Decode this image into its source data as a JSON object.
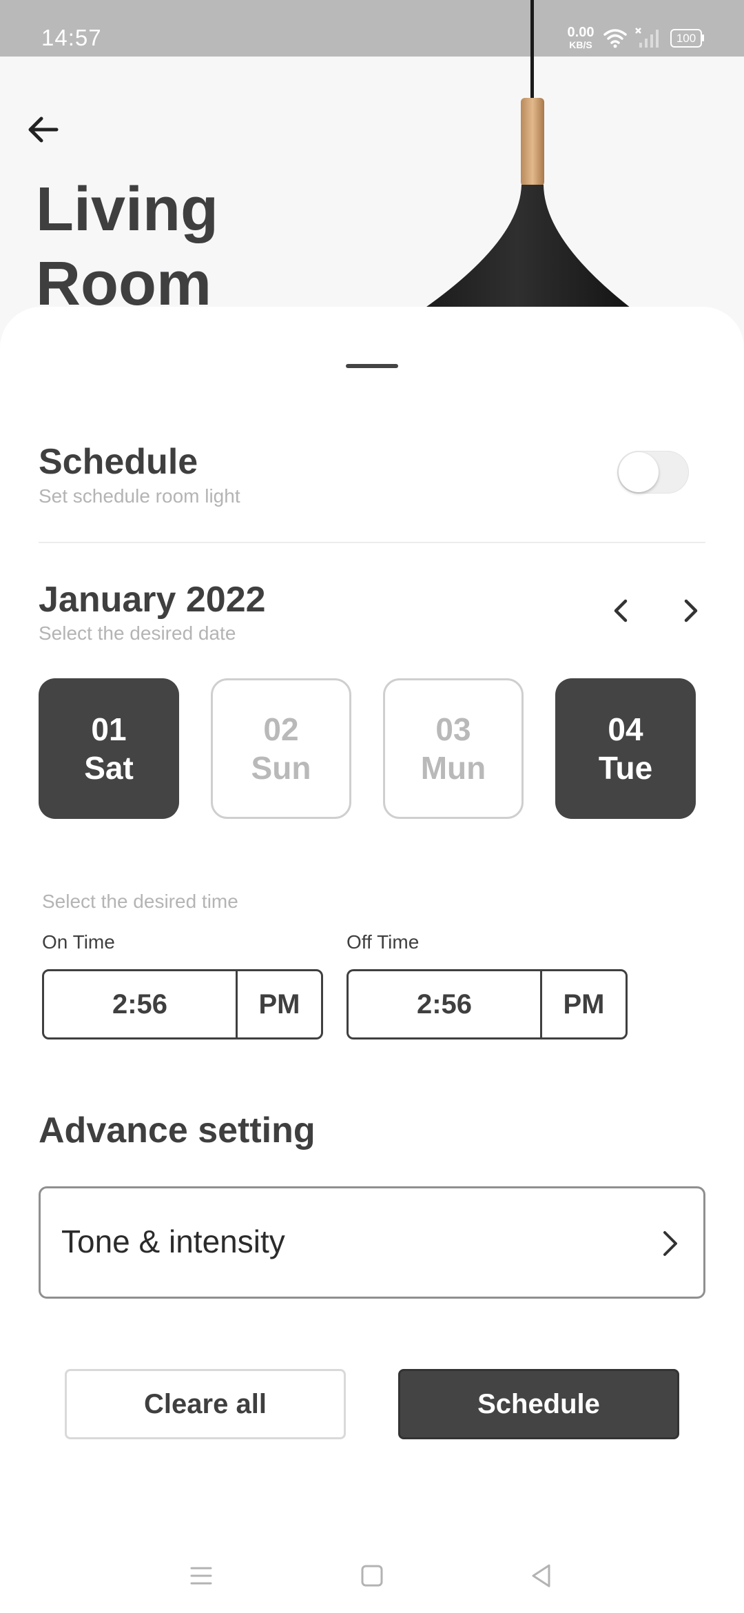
{
  "status_bar": {
    "time": "14:57",
    "speed_value": "0.00",
    "speed_unit": "KB/S",
    "battery": "100"
  },
  "header": {
    "title_line1": "Living",
    "title_line2": "Room"
  },
  "schedule": {
    "title": "Schedule",
    "subtitle": "Set schedule room light",
    "enabled": false
  },
  "calendar": {
    "month": "January 2022",
    "subtitle": "Select the desired date",
    "dates": [
      {
        "day": "01",
        "weekday": "Sat",
        "selected": true
      },
      {
        "day": "02",
        "weekday": "Sun",
        "selected": false
      },
      {
        "day": "03",
        "weekday": "Mun",
        "selected": false
      },
      {
        "day": "04",
        "weekday": "Tue",
        "selected": true
      }
    ]
  },
  "time": {
    "subtitle": "Select the desired time",
    "on_label": "On Time",
    "on_value": "2:56",
    "on_period": "PM",
    "off_label": "Off Time",
    "off_value": "2:56",
    "off_period": "PM"
  },
  "advance": {
    "title": "Advance setting",
    "tone_label": "Tone & intensity"
  },
  "actions": {
    "clear_label": "Cleare all",
    "schedule_label": "Schedule"
  },
  "colors": {
    "primary_dark": "#444444",
    "text": "#3f3f3f",
    "muted": "#b4b4b4",
    "status_bar": "#b9b9b9"
  }
}
